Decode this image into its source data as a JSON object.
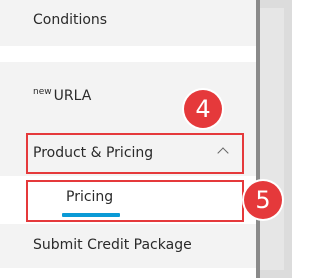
{
  "nav": {
    "items": [
      {
        "label": "Conditions"
      },
      {
        "sup": "new",
        "label": "URLA"
      },
      {
        "label": "Product & Pricing",
        "expanded": true
      },
      {
        "label": "Pricing",
        "selected": true
      },
      {
        "label": "Submit Credit Package"
      }
    ]
  },
  "annotations": {
    "step_product": "4",
    "step_pricing": "5",
    "highlight_color": "#e5393b"
  },
  "colors": {
    "accent_underline": "#0a9ad6",
    "row_shade": "#f3f3f3"
  }
}
